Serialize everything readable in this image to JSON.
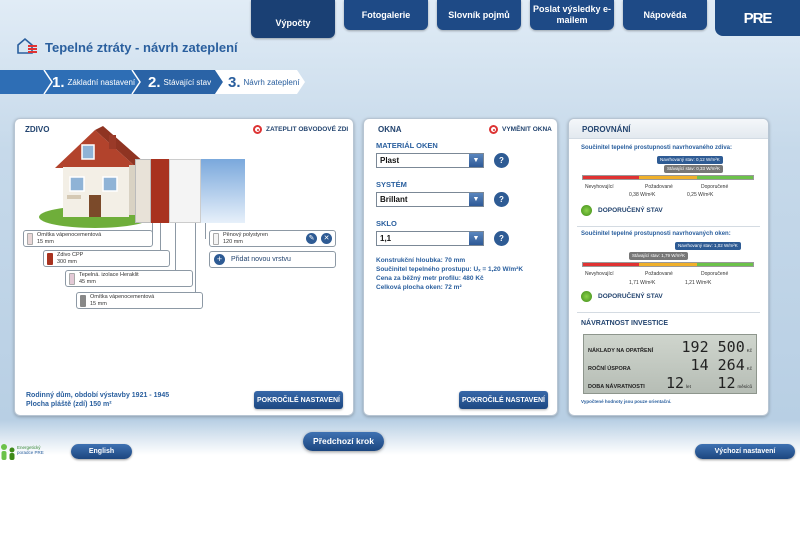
{
  "nav": {
    "items": [
      "Výpočty",
      "Fotogalerie",
      "Slovník pojmů",
      "Poslat výsledky e-mailem",
      "Nápověda"
    ],
    "logo": "PRE"
  },
  "header": {
    "title": "Tepelné ztráty - návrh zateplení"
  },
  "steps": [
    {
      "num": "1.",
      "label": "Základní nastavení"
    },
    {
      "num": "2.",
      "label": "Stávající stav"
    },
    {
      "num": "3.",
      "label": "Návrh zateplení"
    }
  ],
  "wall": {
    "title": "ZDIVO",
    "action": "ZATEPLIT OBVODOVÉ ZDI",
    "layers": [
      {
        "name": "Omítka vápenocementová",
        "thickness": "15 mm",
        "color": "#e8d6d6"
      },
      {
        "name": "Zdivo CPP",
        "thickness": "300 mm",
        "color": "#a8321f"
      },
      {
        "name": "Tepelná. izolace Heraklit",
        "thickness": "45 mm",
        "color": "#e3c9d6"
      },
      {
        "name": "Omítka vápenocementová",
        "thickness": "15 mm",
        "color": "#888888"
      }
    ],
    "new_layer": {
      "name": "Pěnový polystyren",
      "thickness": "120 mm"
    },
    "add_layer": "Přidat novou vrstvu",
    "house_info_1": "Rodinný dům, období výstavby 1921 - 1945",
    "house_info_2": "Plocha pláště (zdí) 150 m²",
    "advanced": "POKROČILÉ NASTAVENÍ"
  },
  "windows": {
    "title": "OKNA",
    "action": "VYMĚNIT OKNA",
    "material_label": "MATERIÁL OKEN",
    "material_value": "Plast",
    "system_label": "SYSTÉM",
    "system_value": "Brillant",
    "glass_label": "SKLO",
    "glass_value": "1,1",
    "help": "?",
    "info": [
      "Konstrukční hloubka: 70 mm",
      "Součinitel tepelného prostupu:  Uₓ = 1,20 W/m²K",
      "Cena za běžný metr profilu: 480 Kč",
      "Celková plocha oken: 72 m²"
    ],
    "advanced": "POKROČILÉ NASTAVENÍ"
  },
  "comparison": {
    "title": "POROVNÁNÍ",
    "wall_title": "Součinitel tepelné prostupnosti navrhovaného zdiva:",
    "wall_proposed": "Navrhovaný stav: 0,12 W/m²K",
    "wall_current": "Stávající stav: 0,33 W/m²K",
    "wall_labels": [
      "Nevyhovující",
      "Požadované",
      "Doporučené"
    ],
    "wall_values": [
      "0,38 W/m²K",
      "0,25 W/m²K"
    ],
    "windows_title": "Součinitel tepelné prostupnosti navrhovaných oken:",
    "win_proposed": "Navrhovaný stav: 1,02 W/m²K",
    "win_current": "Stávající stav: 1,79 W/m²K",
    "win_labels": [
      "Nevyhovující",
      "Požadované",
      "Doporučené"
    ],
    "win_values": [
      "1,71 W/m²K",
      "1,21 W/m²K"
    ],
    "recommended": "DOPORUČENÝ STAV",
    "roi_title": "NÁVRATNOST INVESTICE",
    "costs_label": "NÁKLADY NA OPATŘENÍ",
    "costs_value": "192 500",
    "costs_unit": "Kč",
    "savings_label": "ROČNÍ ÚSPORA",
    "savings_value": "14 264",
    "savings_unit": "Kč",
    "payback_label": "DOBA NÁVRATNOSTI",
    "payback_years": "12",
    "payback_years_unit": "let",
    "payback_months": "12",
    "payback_months_unit": "měsíců",
    "note": "Vypočtené hodnoty jsou pouze orientační."
  },
  "footer": {
    "prev": "Předchozí krok",
    "english": "English",
    "reset": "Výchozí nastavení",
    "logo_line1": "Energetický",
    "logo_line2": "poradce PRE"
  },
  "colors": {
    "brand": "#1e4a86",
    "accent_red": "#e03232",
    "ok_green": "#6cc24a"
  }
}
